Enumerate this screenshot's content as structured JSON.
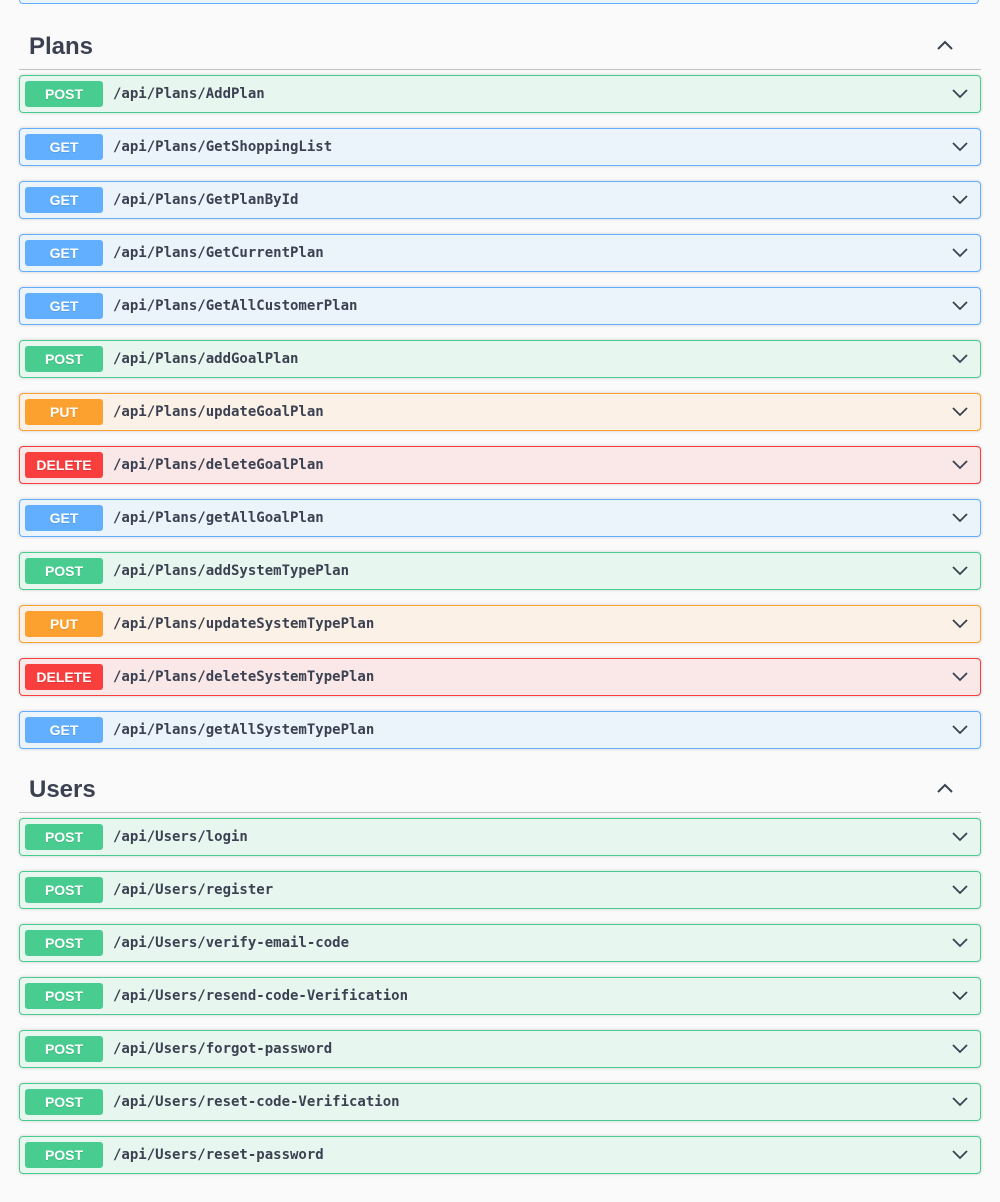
{
  "colors": {
    "post": "#49cc90",
    "get": "#61affe",
    "put": "#fca130",
    "delete": "#f93e3e",
    "text": "#3b4151"
  },
  "sections": [
    {
      "title": "Plans",
      "toggle_icon": "chevron-up-icon",
      "operations": [
        {
          "method": "POST",
          "path": "/api/Plans/AddPlan"
        },
        {
          "method": "GET",
          "path": "/api/Plans/GetShoppingList"
        },
        {
          "method": "GET",
          "path": "/api/Plans/GetPlanById"
        },
        {
          "method": "GET",
          "path": "/api/Plans/GetCurrentPlan"
        },
        {
          "method": "GET",
          "path": "/api/Plans/GetAllCustomerPlan"
        },
        {
          "method": "POST",
          "path": "/api/Plans/addGoalPlan"
        },
        {
          "method": "PUT",
          "path": "/api/Plans/updateGoalPlan"
        },
        {
          "method": "DELETE",
          "path": "/api/Plans/deleteGoalPlan"
        },
        {
          "method": "GET",
          "path": "/api/Plans/getAllGoalPlan"
        },
        {
          "method": "POST",
          "path": "/api/Plans/addSystemTypePlan"
        },
        {
          "method": "PUT",
          "path": "/api/Plans/updateSystemTypePlan"
        },
        {
          "method": "DELETE",
          "path": "/api/Plans/deleteSystemTypePlan"
        },
        {
          "method": "GET",
          "path": "/api/Plans/getAllSystemTypePlan"
        }
      ]
    },
    {
      "title": "Users",
      "toggle_icon": "chevron-up-icon",
      "operations": [
        {
          "method": "POST",
          "path": "/api/Users/login"
        },
        {
          "method": "POST",
          "path": "/api/Users/register"
        },
        {
          "method": "POST",
          "path": "/api/Users/verify-email-code"
        },
        {
          "method": "POST",
          "path": "/api/Users/resend-code-Verification"
        },
        {
          "method": "POST",
          "path": "/api/Users/forgot-password"
        },
        {
          "method": "POST",
          "path": "/api/Users/reset-code-Verification"
        },
        {
          "method": "POST",
          "path": "/api/Users/reset-password"
        }
      ]
    }
  ]
}
